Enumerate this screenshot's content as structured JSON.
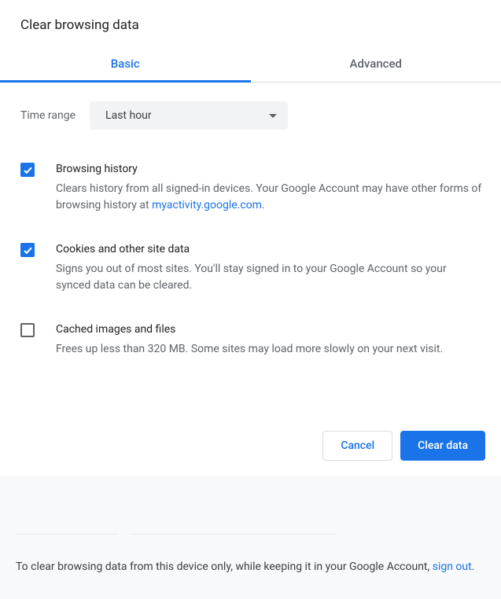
{
  "title": "Clear browsing data",
  "tabs": {
    "basic": "Basic",
    "advanced": "Advanced"
  },
  "time_range": {
    "label": "Time range",
    "selected": "Last hour"
  },
  "options": [
    {
      "checked": true,
      "title": "Browsing history",
      "desc_pre": "Clears history from all signed-in devices. Your Google Account may have other forms of browsing history at ",
      "link": "myactivity.google.com",
      "desc_post": "."
    },
    {
      "checked": true,
      "title": "Cookies and other site data",
      "desc_pre": "Signs you out of most sites. You'll stay signed in to your Google Account so your synced data can be cleared.",
      "link": "",
      "desc_post": ""
    },
    {
      "checked": false,
      "title": "Cached images and files",
      "desc_pre": "Frees up less than 320 MB. Some sites may load more slowly on your next visit.",
      "link": "",
      "desc_post": ""
    }
  ],
  "buttons": {
    "cancel": "Cancel",
    "clear": "Clear data"
  },
  "footer": {
    "pre": "To clear browsing data from this device only, while keeping it in your Google Account, ",
    "link": "sign out",
    "post": "."
  }
}
